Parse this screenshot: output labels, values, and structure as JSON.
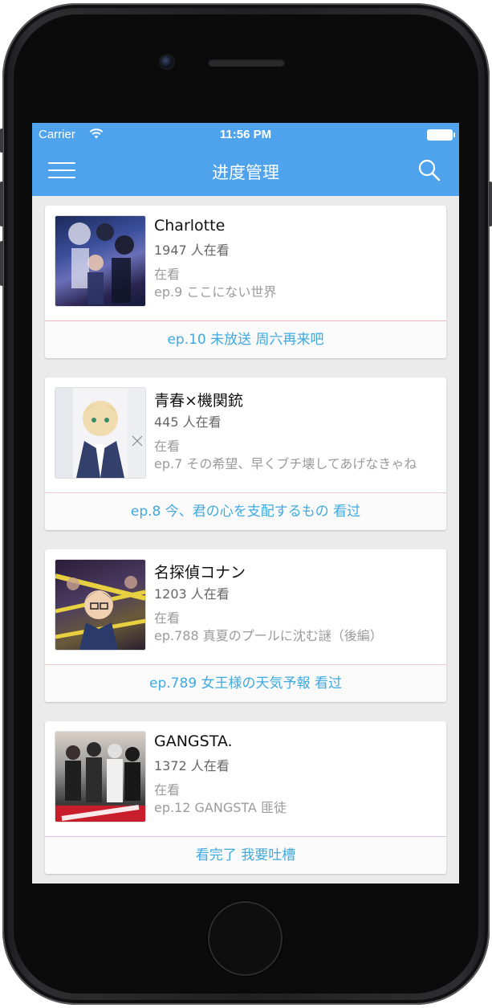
{
  "status_bar": {
    "carrier": "Carrier",
    "time": "11:56 PM"
  },
  "nav": {
    "title": "进度管理",
    "menu_icon": "hamburger-menu-icon",
    "search_icon": "search-icon"
  },
  "colors": {
    "accent": "#4ea3ec",
    "action_text": "#3fa9e0"
  },
  "anime": [
    {
      "title": "Charlotte",
      "watchers": "1947 人在看",
      "status": "在看",
      "last_episode": "ep.9 ここにない世界",
      "next_action": "ep.10 未放送 周六再来吧",
      "divider_color": "#f0b8bc"
    },
    {
      "title": "青春×機関銃",
      "watchers": "445 人在看",
      "status": "在看",
      "last_episode": "ep.7 その希望、早くブチ壊してあげなきゃね",
      "next_action": "ep.8 今、君の心を支配するもの 看过",
      "divider_color": "#f0c8d8"
    },
    {
      "title": "名探偵コナン",
      "watchers": "1203 人在看",
      "status": "在看",
      "last_episode": "ep.788 真夏のプールに沈む謎（後編）",
      "next_action": "ep.789 女王様の天気予報 看过",
      "divider_color": "#f0c8cc"
    },
    {
      "title": "GANGSTA.",
      "watchers": "1372 人在看",
      "status": "在看",
      "last_episode": "ep.12 GANGSTA 匪徒",
      "next_action": "看完了 我要吐槽",
      "divider_color": "#d8c0e8"
    }
  ]
}
